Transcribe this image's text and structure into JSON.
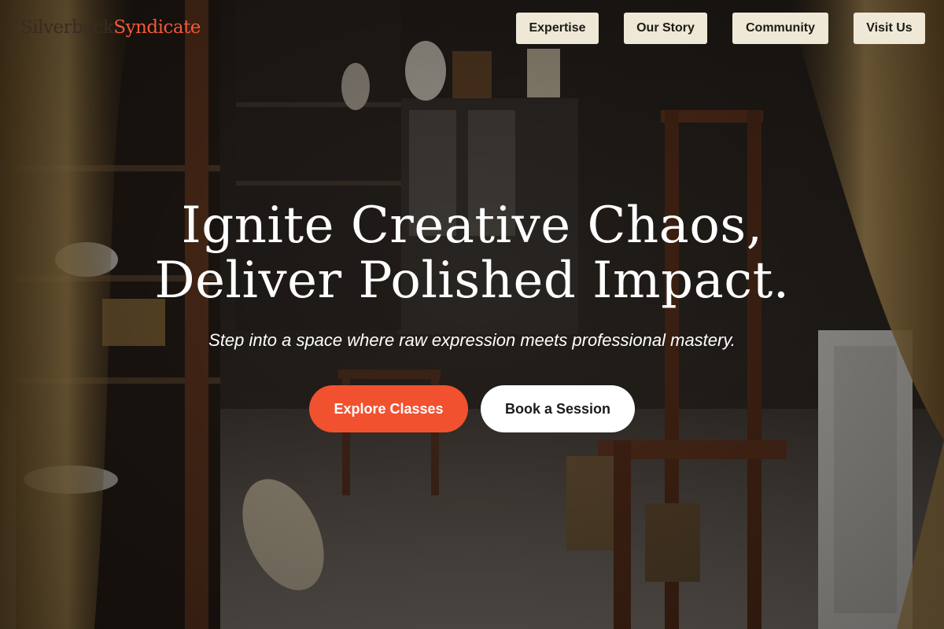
{
  "brand": {
    "part1": "Silverback",
    "part2": "Syndicate"
  },
  "nav": {
    "items": [
      {
        "label": "Expertise"
      },
      {
        "label": "Our Story"
      },
      {
        "label": "Community"
      },
      {
        "label": "Visit Us"
      }
    ]
  },
  "hero": {
    "title_line1": "Ignite Creative Chaos,",
    "title_line2": "Deliver Polished Impact.",
    "subtitle": "Step into a space where raw expression meets professional mastery.",
    "primary_cta": "Explore Classes",
    "secondary_cta": "Book a Session"
  },
  "colors": {
    "accent": "#f2512f",
    "nav_button_bg": "#efe8d6",
    "brand_dark": "#3a2a20",
    "brand_accent": "#f25a38"
  }
}
